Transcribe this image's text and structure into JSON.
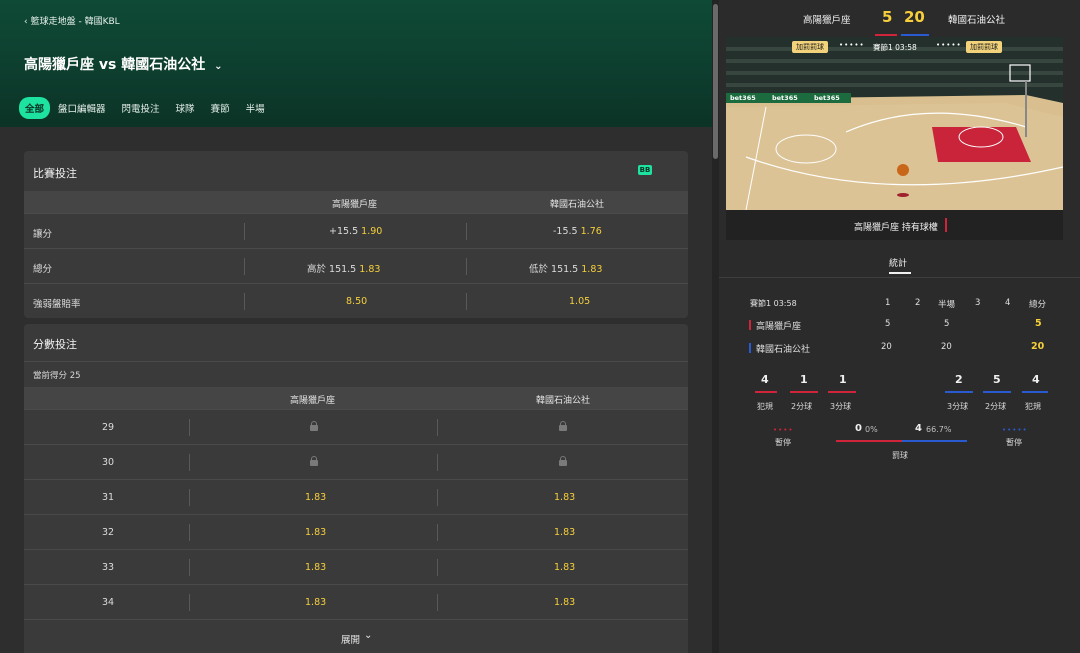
{
  "header": {
    "breadcrumb": "籃球走地盤 - 韓國KBL",
    "title": "高陽獵戶座 vs 韓國石油公社",
    "tabs": [
      "全部",
      "盤口編輯器",
      "閃電投注",
      "球隊",
      "賽節",
      "半場"
    ]
  },
  "match_betting": {
    "title": "比賽投注",
    "badge": "BB",
    "team1": "高陽獵戶座",
    "team2": "韓國石油公社",
    "rows": [
      {
        "label": "讓分",
        "t1_line": "+15.5",
        "t1_odds": "1.90",
        "t2_line": "-15.5",
        "t2_odds": "1.76"
      },
      {
        "label": "總分",
        "t1_line": "高於 151.5",
        "t1_odds": "1.83",
        "t2_line": "低於 151.5",
        "t2_odds": "1.83"
      },
      {
        "label": "強弱盤賠率",
        "t1_line": "",
        "t1_odds": "8.50",
        "t2_line": "",
        "t2_odds": "1.05"
      }
    ]
  },
  "score_betting": {
    "title": "分數投注",
    "current_score": "當前得分 25",
    "team1": "高陽獵戶座",
    "team2": "韓國石油公社",
    "rows": [
      {
        "score": "29",
        "t1": "",
        "t2": "",
        "locked": true
      },
      {
        "score": "30",
        "t1": "",
        "t2": "",
        "locked": true
      },
      {
        "score": "31",
        "t1": "1.83",
        "t2": "1.83",
        "locked": false
      },
      {
        "score": "32",
        "t1": "1.83",
        "t2": "1.83",
        "locked": false
      },
      {
        "score": "33",
        "t1": "1.83",
        "t2": "1.83",
        "locked": false
      },
      {
        "score": "34",
        "t1": "1.83",
        "t2": "1.83",
        "locked": false
      }
    ],
    "expand_label": "展開"
  },
  "scoreboard": {
    "team1": "高陽獵戶座",
    "team2": "韓國石油公社",
    "score1": "5",
    "score2": "20",
    "bonus_left": "加罰罰球",
    "bonus_right": "加罰罰球",
    "period_clock": "賽節1 03:58",
    "possession": "高陽獵戶座 持有球權",
    "court_ads": [
      "bet365",
      "bet365",
      "bet365"
    ]
  },
  "stats": {
    "tab": "統計",
    "period_label": "賽節1 03:58",
    "columns": [
      "1",
      "2",
      "半場",
      "3",
      "4",
      "總分"
    ],
    "team1": {
      "name": "高陽獵戶座",
      "q1": "5",
      "half": "5",
      "total": "5"
    },
    "team2": {
      "name": "韓國石油公社",
      "q1": "20",
      "half": "20",
      "total": "20"
    },
    "left": [
      {
        "value": "4",
        "label": "犯規"
      },
      {
        "value": "1",
        "label": "2分球"
      },
      {
        "value": "1",
        "label": "3分球"
      }
    ],
    "right": [
      {
        "value": "2",
        "label": "3分球"
      },
      {
        "value": "5",
        "label": "2分球"
      },
      {
        "value": "4",
        "label": "犯規"
      }
    ],
    "timeout_label_left": "暫停",
    "timeout_label_right": "暫停",
    "ft_left_value": "0",
    "ft_left_pct": "0%",
    "ft_right_value": "4",
    "ft_right_pct": "66.7%",
    "ft_label": "罰球"
  },
  "colors": {
    "accent": "#1ee3a0",
    "odds": "#f6cf3a",
    "team1": "#d0243a",
    "team2": "#2a5ad0"
  }
}
